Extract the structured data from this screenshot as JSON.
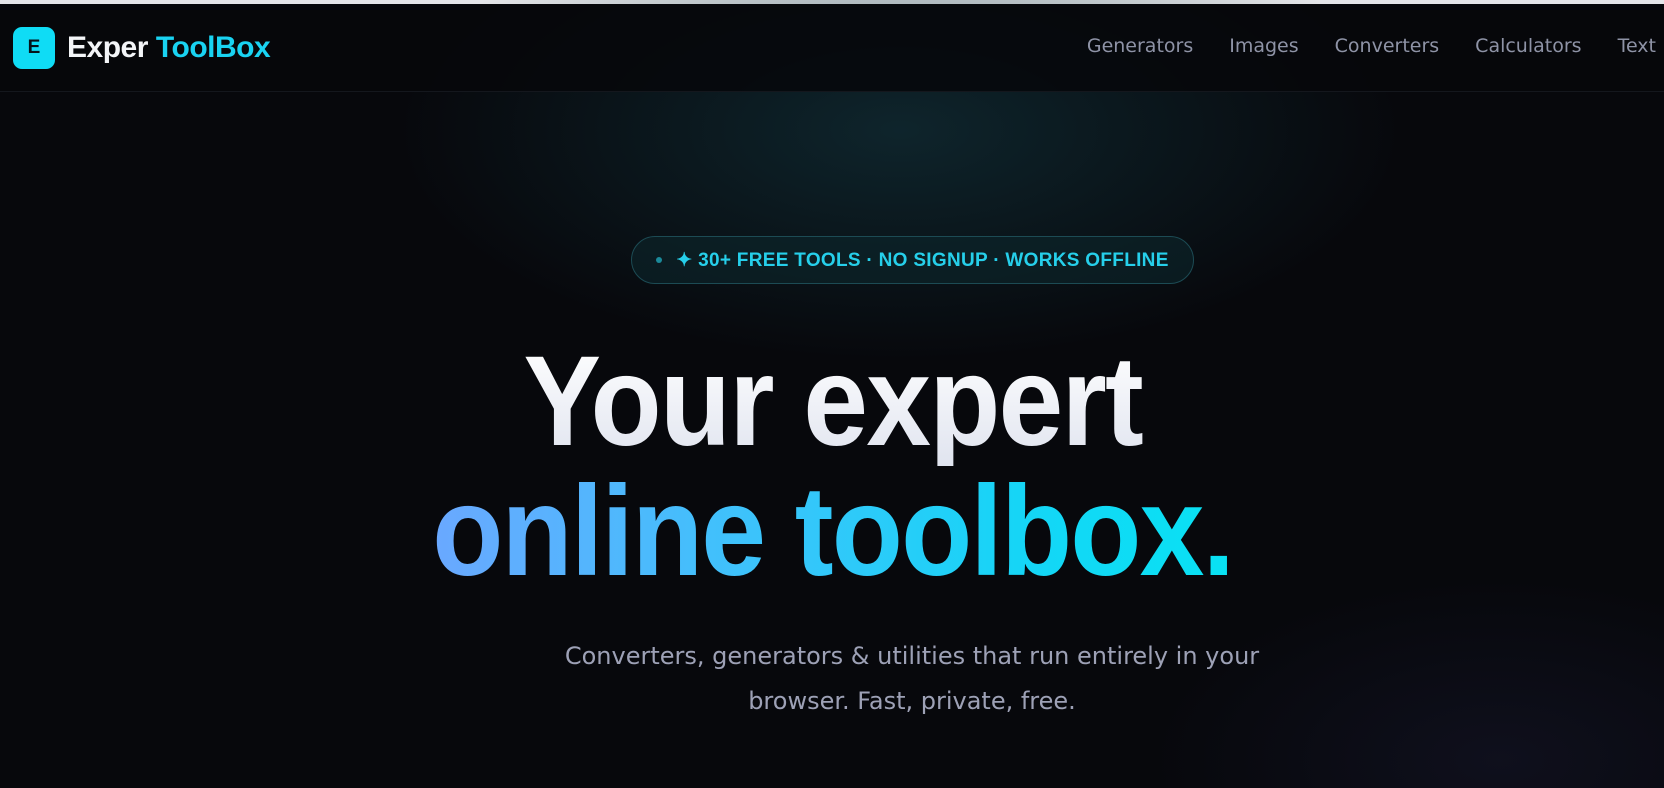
{
  "header": {
    "logo_mark": "E",
    "brand_word1": "Exper",
    "brand_word2": "ToolBox",
    "nav": [
      "Generators",
      "Images",
      "Converters",
      "Calculators",
      "Text"
    ]
  },
  "hero": {
    "badge": "✦ 30+ FREE TOOLS · NO SIGNUP · WORKS OFFLINE",
    "headline_line1": "Your expert",
    "headline_line2": "online toolbox.",
    "subtitle": "Converters, generators & utilities that run entirely in your browser. Fast, private, free."
  },
  "colors": {
    "background": "#07080c",
    "accent": "#19d3f2",
    "gradient_start": "#6aa8ff",
    "gradient_end": "#08e2f3",
    "nav_text": "#8e93a6",
    "subtitle_text": "#9da1b6"
  }
}
